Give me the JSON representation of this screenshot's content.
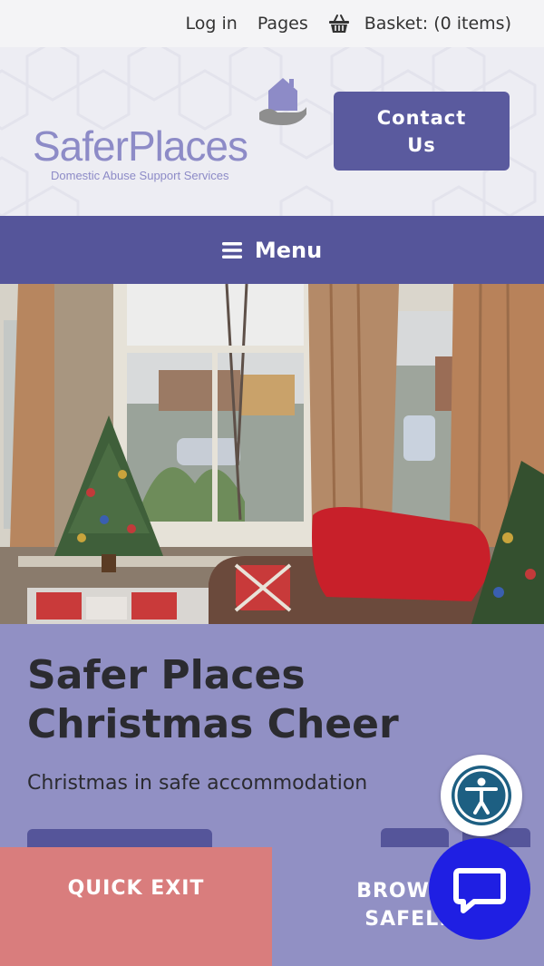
{
  "topbar": {
    "login": "Log in",
    "pages": "Pages",
    "basket": "Basket: (0 items)"
  },
  "header": {
    "logo_name": "SaferPlaces",
    "logo_tagline": "Domestic Abuse Support Services",
    "contact_line1": "Contact",
    "contact_line2": "Us"
  },
  "menu": {
    "label": "Menu",
    "icon": "hamburger-icon"
  },
  "hero": {
    "title": "Safer Places Christmas Cheer",
    "subtitle": "Christmas in safe accommodation"
  },
  "footer": {
    "quick_exit": "QUICK EXIT",
    "browse_line1": "BROWSE",
    "browse_line2": "SAFELY"
  },
  "widgets": {
    "accessibility_icon": "accessibility-icon",
    "chat_icon": "chat-icon"
  },
  "colors": {
    "brand_purple": "#55559a",
    "lavender": "#9190c4",
    "quick_exit_red": "#d97d7d",
    "chat_blue": "#1f1fe3",
    "logo_text": "#8d8bc7"
  }
}
